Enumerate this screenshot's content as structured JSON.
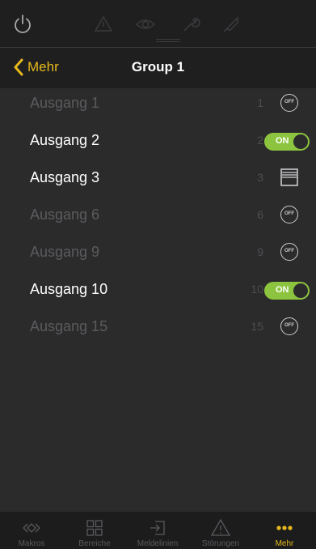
{
  "colors": {
    "accent": "#e7b91c",
    "toggle_on": "#8dc43f",
    "background": "#2b2b2c",
    "bar": "#1f1f20",
    "dim_text": "#5b5b5e"
  },
  "toolbar": {
    "icons": [
      "power-icon",
      "warning-icon",
      "eye-icon",
      "wrench-icon",
      "tag-icon"
    ]
  },
  "nav": {
    "back_label": "Mehr",
    "title": "Group 1"
  },
  "outputs": [
    {
      "name": "Ausgang 1",
      "number": "1",
      "control": "off-button",
      "state": "off",
      "active": false
    },
    {
      "name": "Ausgang 2",
      "number": "2",
      "control": "toggle",
      "state": "ON",
      "active": true
    },
    {
      "name": "Ausgang 3",
      "number": "3",
      "control": "shutter",
      "state": "shutter",
      "active": true
    },
    {
      "name": "Ausgang 6",
      "number": "6",
      "control": "off-button",
      "state": "off",
      "active": false
    },
    {
      "name": "Ausgang 9",
      "number": "9",
      "control": "off-button",
      "state": "off",
      "active": false
    },
    {
      "name": "Ausgang 10",
      "number": "10",
      "control": "toggle",
      "state": "ON",
      "active": true
    },
    {
      "name": "Ausgang 15",
      "number": "15",
      "control": "off-button",
      "state": "off",
      "active": false
    }
  ],
  "off_label": "OFF",
  "tabs": [
    {
      "label": "Makros",
      "icon": "macro-icon",
      "active": false
    },
    {
      "label": "Bereiche",
      "icon": "grid-icon",
      "active": false
    },
    {
      "label": "Meldelinien",
      "icon": "signin-icon",
      "active": false
    },
    {
      "label": "Störungen",
      "icon": "warning-icon",
      "active": false
    },
    {
      "label": "Mehr",
      "icon": "more-icon",
      "active": true
    }
  ]
}
